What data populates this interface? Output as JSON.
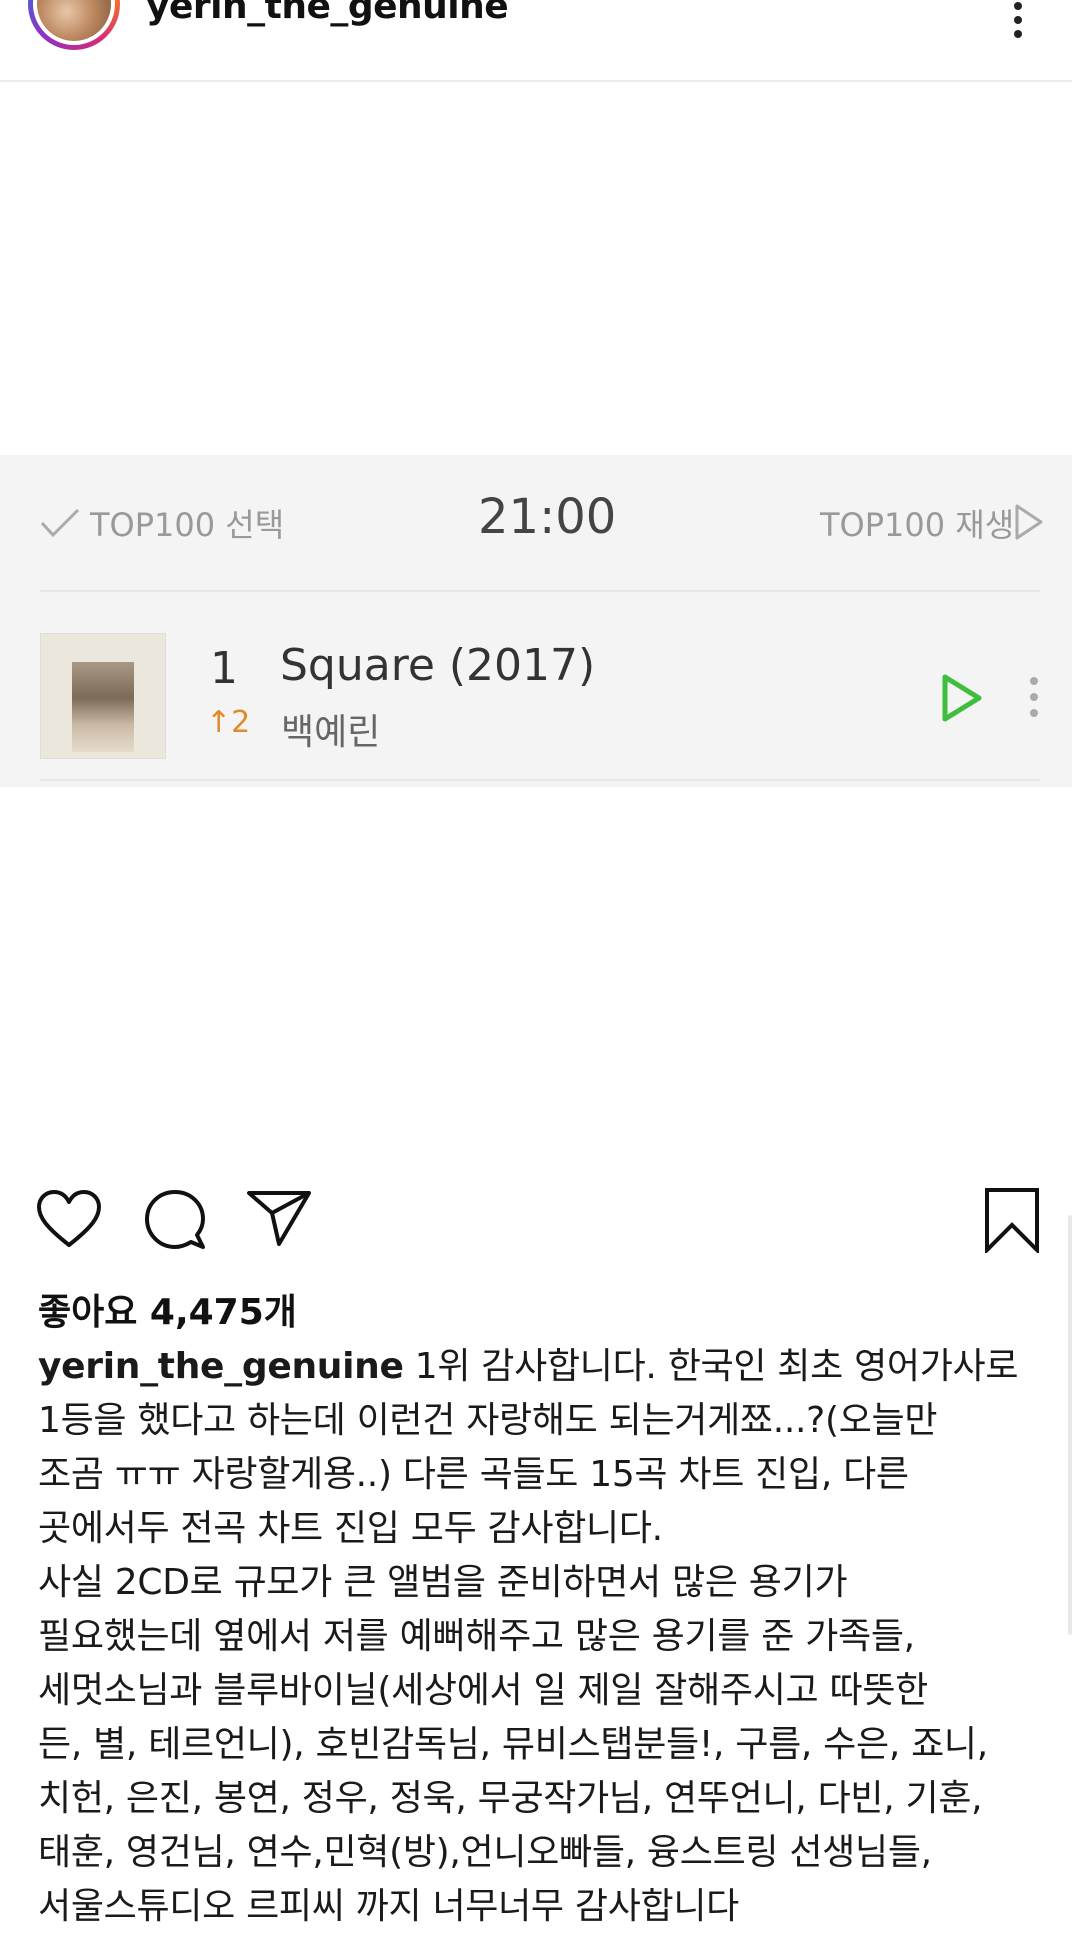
{
  "post_header": {
    "username": "yerin_the_genuine"
  },
  "chart_embed": {
    "top_select_label": "TOP100 선택",
    "time": "21:00",
    "top_play_label": "TOP100 재생",
    "song": {
      "rank": "1",
      "rank_change": "↑2",
      "title": "Square (2017)",
      "artist": "백예린"
    },
    "accent_color": "#3fbd3f"
  },
  "actions": {
    "icons": [
      "heart-icon",
      "comment-icon",
      "share-icon",
      "bookmark-icon"
    ]
  },
  "likes": {
    "label": "좋아요 4,475개"
  },
  "caption": {
    "username": "yerin_the_genuine",
    "text": " 1위 감사합니다. 한국인 최초 영어가사로\n1등을 했다고 하는데 이런건 자랑해도 되는거게쬬...?(오늘만\n조곰 ㅠㅠ 자랑할게용..) 다른 곡들도 15곡 차트 진입, 다른\n곳에서두 전곡 차트 진입 모두 감사합니다.\n사실 2CD로 규모가 큰 앨범을 준비하면서 많은 용기가\n필요했는데 옆에서 저를 예뻐해주고 많은 용기를 준 가족들,\n세멋소님과 블루바이닐(세상에서 일 제일 잘해주시고 따뜻한\n든, 별, 테르언니), 호빈감독님, 뮤비스탭분들!, 구름, 수은, 죠니,\n치헌, 은진, 봉연, 정우, 정욱, 무궁작가님, 연뚜언니, 다빈, 기훈,\n태훈, 영건님, 연수,민혁(방),언니오빠들, 융스트링 선생님들,\n서울스튜디오 르피씨 까지 너무너무 감사합니다"
  }
}
